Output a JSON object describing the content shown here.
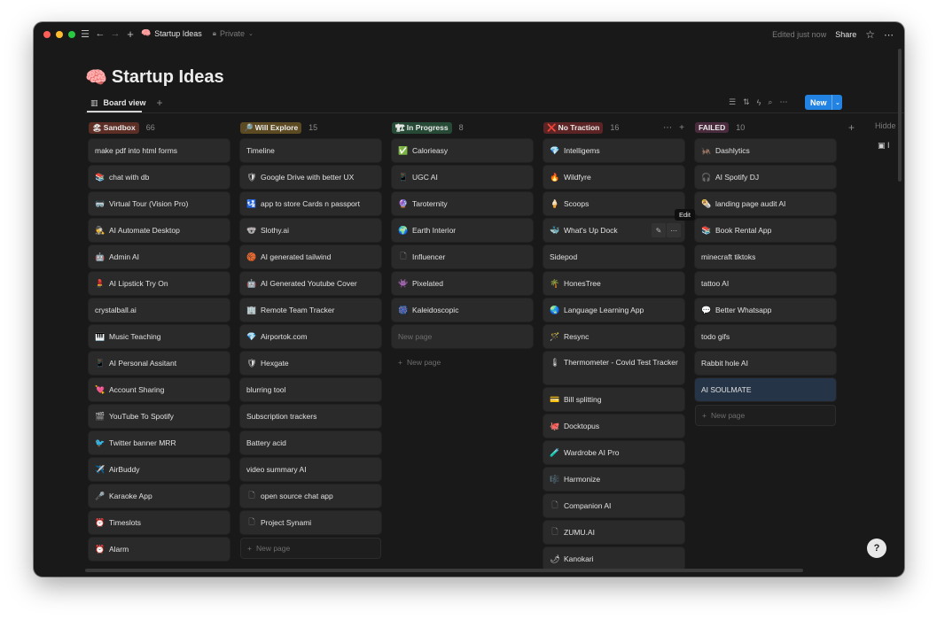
{
  "window": {
    "breadcrumb_emoji": "🧠",
    "breadcrumb_title": "Startup Ideas",
    "privacy": "Private",
    "edited": "Edited just now",
    "share": "Share"
  },
  "page": {
    "emoji": "🧠",
    "title": "Startup Ideas",
    "view_label": "Board view",
    "new_label": "New",
    "hidden_label": "Hidde",
    "tooltip": "Edit"
  },
  "columns": [
    {
      "name": "Sandbox",
      "emoji": "🏖",
      "count": "66",
      "color": "#5c2e26",
      "cards": [
        {
          "icon": "",
          "text": "make pdf into html forms"
        },
        {
          "icon": "📚",
          "text": "chat with db"
        },
        {
          "icon": "🥽",
          "text": "Virtual Tour (Vision Pro)"
        },
        {
          "icon": "🕵",
          "text": "AI Automate Desktop"
        },
        {
          "icon": "🤖",
          "text": "Admin AI"
        },
        {
          "icon": "💄",
          "text": "AI Lipstick Try On"
        },
        {
          "icon": "",
          "text": "crystalball.ai"
        },
        {
          "icon": "🎹",
          "text": "Music Teaching"
        },
        {
          "icon": "📱",
          "text": "AI Personal Assitant"
        },
        {
          "icon": "💘",
          "text": "Account Sharing"
        },
        {
          "icon": "🎬",
          "text": "YouTube To Spotify"
        },
        {
          "icon": "🐦",
          "text": "Twitter banner MRR"
        },
        {
          "icon": "✈️",
          "text": "AirBuddy"
        },
        {
          "icon": "🎤",
          "text": "Karaoke App"
        },
        {
          "icon": "⏰",
          "text": "Timeslots"
        },
        {
          "icon": "⏰",
          "text": "Alarm"
        }
      ],
      "new_page": ""
    },
    {
      "name": "Will Explore",
      "emoji": "🔎",
      "count": "15",
      "color": "#5b4a22",
      "cards": [
        {
          "icon": "",
          "text": "Timeline"
        },
        {
          "icon": "🛡",
          "text": "Google Drive with better UX"
        },
        {
          "icon": "🛂",
          "text": "app to store Cards n passport"
        },
        {
          "icon": "🐨",
          "text": "Slothy.ai"
        },
        {
          "icon": "🏀",
          "text": "AI generated tailwind"
        },
        {
          "icon": "🤖",
          "text": "AI Generated Youtube Cover"
        },
        {
          "icon": "🏢",
          "text": "Remote Team Tracker"
        },
        {
          "icon": "💎",
          "text": "Airportok.com"
        },
        {
          "icon": "🛡",
          "text": "Hexgate"
        },
        {
          "icon": "",
          "text": "blurring tool"
        },
        {
          "icon": "",
          "text": "Subscription trackers"
        },
        {
          "icon": "",
          "text": "Battery acid"
        },
        {
          "icon": "",
          "text": "video summary AI"
        },
        {
          "icon": "doc",
          "text": "open source chat app"
        },
        {
          "icon": "doc",
          "text": "Project Synami"
        }
      ],
      "new_page": "New page"
    },
    {
      "name": "In Progress",
      "emoji": "🏗",
      "count": "8",
      "color": "#264a35",
      "cards": [
        {
          "icon": "✅",
          "text": "Calorieasy"
        },
        {
          "icon": "📱",
          "text": "UGC AI"
        },
        {
          "icon": "🔮",
          "text": "Taroternity"
        },
        {
          "icon": "🌍",
          "text": "Earth Interior"
        },
        {
          "icon": "doc",
          "text": "Influencer"
        },
        {
          "icon": "👾",
          "text": "Pixelated"
        },
        {
          "icon": "🎆",
          "text": "Kaleidoscopic"
        }
      ],
      "new_page_ghost": "New page",
      "new_page": "New page"
    },
    {
      "name": "No Traction",
      "emoji": "❌",
      "count": "16",
      "color": "#5c2424",
      "cards": [
        {
          "icon": "💎",
          "text": "Intelligems"
        },
        {
          "icon": "🔥",
          "text": "Wildfyre"
        },
        {
          "icon": "🍦",
          "text": "Scoops"
        },
        {
          "icon": "🐳",
          "text": "What's Up Dock"
        },
        {
          "icon": "",
          "text": "Sidepod"
        },
        {
          "icon": "🌴",
          "text": "HonesTree"
        },
        {
          "icon": "🌏",
          "text": "Language Learning App"
        },
        {
          "icon": "🪄",
          "text": "Resync"
        },
        {
          "icon": "🌡",
          "text": "Thermometer - Covid Test Tracker",
          "tall": true
        },
        {
          "icon": "💳",
          "text": "Bill splitting"
        },
        {
          "icon": "🐙",
          "text": "Docktopus"
        },
        {
          "icon": "🧪",
          "text": "Wardrobe AI Pro"
        },
        {
          "icon": "🎼",
          "text": "Harmonize"
        },
        {
          "icon": "doc",
          "text": "Companion AI"
        },
        {
          "icon": "doc",
          "text": "ZUMU.AI"
        },
        {
          "icon": "🌶",
          "text": "Kanokari"
        }
      ],
      "new_page": ""
    },
    {
      "name": "FAILED",
      "emoji": "",
      "count": "10",
      "color": "#4a2b3d",
      "cards": [
        {
          "icon": "🦗",
          "text": "Dashlytics"
        },
        {
          "icon": "🎧",
          "text": "AI Spotify DJ"
        },
        {
          "icon": "🌯",
          "text": "landing page audit AI"
        },
        {
          "icon": "📚",
          "text": "Book Rental App"
        },
        {
          "icon": "",
          "text": "minecraft tiktoks"
        },
        {
          "icon": "",
          "text": "tattoo AI"
        },
        {
          "icon": "💬",
          "text": "Better Whatsapp"
        },
        {
          "icon": "",
          "text": "todo gifs"
        },
        {
          "icon": "",
          "text": "Rabbit hole AI"
        },
        {
          "icon": "",
          "text": "AI SOULMATE",
          "selected": true
        }
      ],
      "new_page": "New page"
    }
  ]
}
